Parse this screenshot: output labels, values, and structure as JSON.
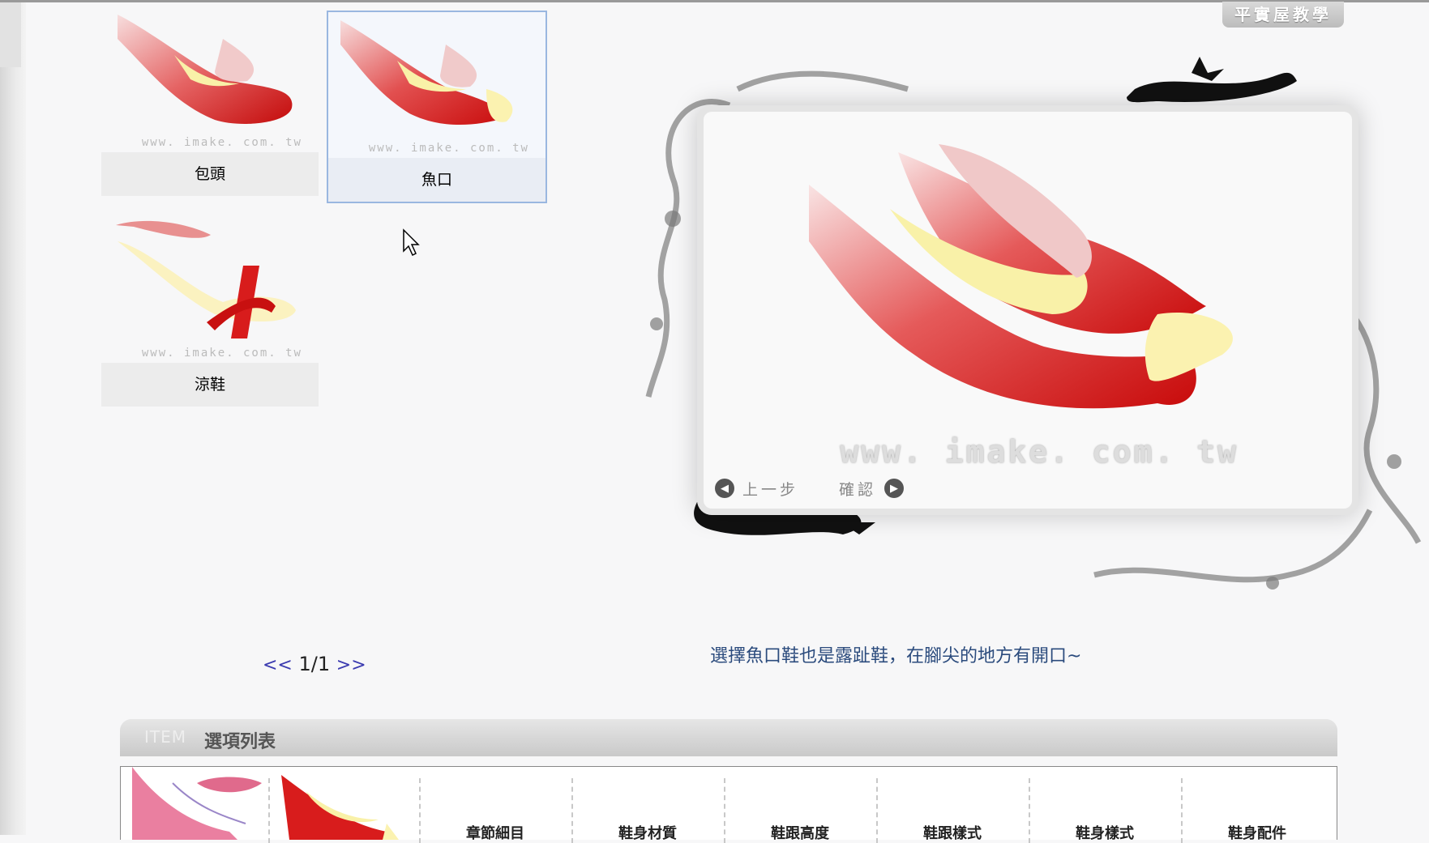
{
  "header": {
    "teach_button": "平實屋教學"
  },
  "cards": [
    {
      "label": "包頭",
      "watermark": "www. imake. com. tw",
      "selected": false
    },
    {
      "label": "魚口",
      "watermark": "www. imake. com. tw",
      "selected": true
    },
    {
      "label": "涼鞋",
      "watermark": "www. imake. com. tw",
      "selected": false
    }
  ],
  "pager": {
    "prev": "<<",
    "text": "1/1",
    "next": ">>"
  },
  "preview": {
    "watermark": "www. imake. com. tw",
    "back_label": "上一步",
    "confirm_label": "確認"
  },
  "caption": "選擇魚口鞋也是露趾鞋，在腳尖的地方有開口~",
  "item_list": {
    "title_en": "ITEM",
    "title": "選項列表",
    "columns": [
      "章節細目",
      "鞋身材質",
      "鞋跟高度",
      "鞋跟樣式",
      "鞋身樣式",
      "鞋身配件"
    ]
  },
  "colors": {
    "accent_red": "#d81c1c",
    "cream": "#fbf2b0",
    "caption_blue": "#2b4b7d",
    "pager_blue": "#3b3bb0"
  }
}
